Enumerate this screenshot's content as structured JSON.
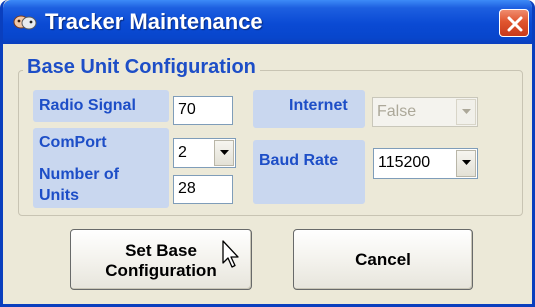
{
  "window": {
    "title": "Tracker Maintenance",
    "icon": "tracker-app-icon",
    "close_icon": "close-icon"
  },
  "group": {
    "title": "Base Unit Configuration"
  },
  "fields": {
    "radio_signal": {
      "label": "Radio Signal",
      "value": "70"
    },
    "com_port": {
      "label": "ComPort",
      "value": "2"
    },
    "number_of_units": {
      "label_line1": "Number of",
      "label_line2": "Units",
      "value": "28"
    },
    "internet": {
      "label": "Internet",
      "value": "False",
      "enabled": false
    },
    "baud_rate": {
      "label": "Baud Rate",
      "value": "115200"
    }
  },
  "buttons": {
    "set_base_line1": "Set Base",
    "set_base_line2": "Configuration",
    "cancel": "Cancel"
  },
  "colors": {
    "label_text": "#1d4ec7",
    "label_panel": "#c9d7ef",
    "dialog_bg": "#ece9d8",
    "titlebar": "#0a4ad4",
    "close_button": "#e0552f"
  }
}
